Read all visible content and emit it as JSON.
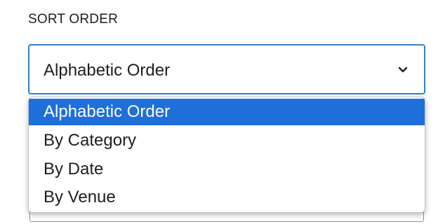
{
  "sort_order": {
    "label": "SORT ORDER",
    "selected_value": "Alphabetic Order",
    "options": [
      "Alphabetic Order",
      "By Category",
      "By Date",
      "By Venue"
    ],
    "selected_index": 0,
    "icon": "chevron-down-icon",
    "colors": {
      "focus_border": "#3582c4",
      "highlight": "#1e6fd9",
      "text": "#1e1e1e"
    }
  }
}
